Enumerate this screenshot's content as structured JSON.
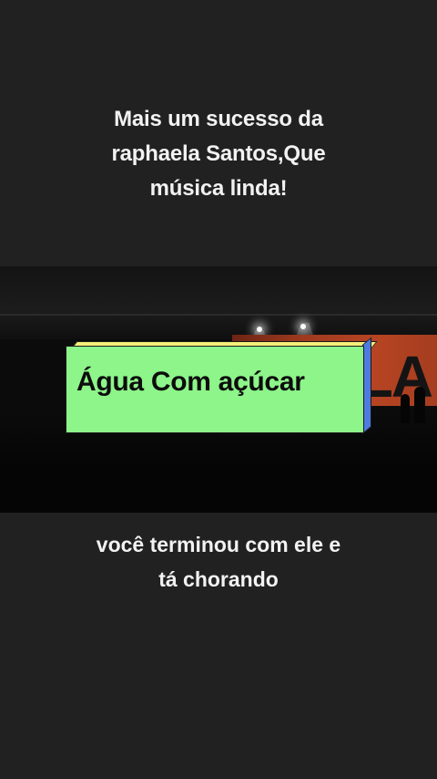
{
  "captions": {
    "top_line1": "Mais um sucesso da",
    "top_line2": "raphaela Santos,Que",
    "top_line3": "música linda!",
    "bottom_line1": "você terminou com ele e",
    "bottom_line2": "tá chorando"
  },
  "title_card": {
    "text": "Água Com açúcar"
  },
  "stage": {
    "wall_letters": "ELA"
  },
  "colors": {
    "background": "#212121",
    "title_face": "#8df58a",
    "title_top": "#f6f07a",
    "title_side": "#4d7be0",
    "stage_wall": "#b64422"
  }
}
